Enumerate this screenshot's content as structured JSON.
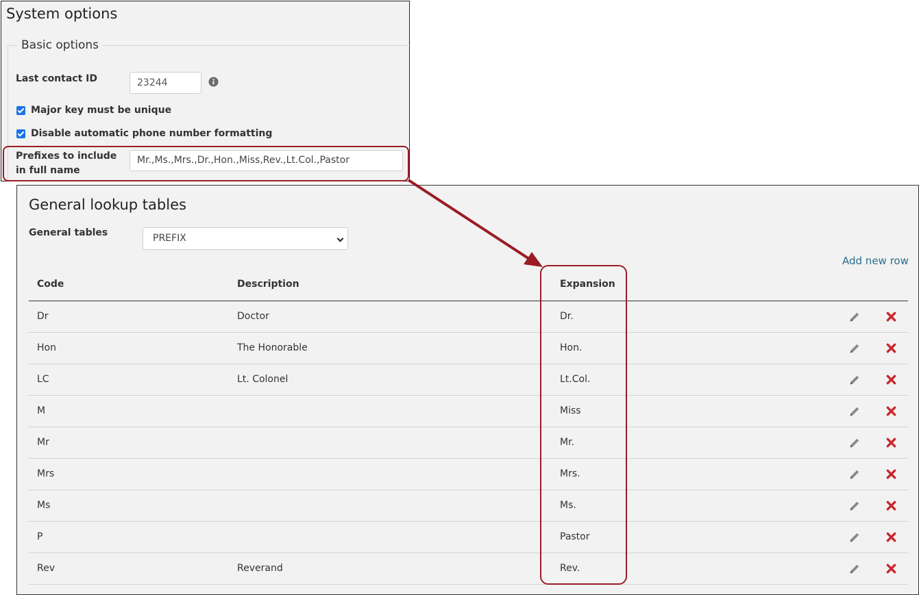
{
  "system_options": {
    "title": "System options",
    "section_legend": "Basic options",
    "last_contact_id": {
      "label": "Last contact ID",
      "value": "23244"
    },
    "checkboxes": [
      {
        "label": "Major key must be unique",
        "checked": true
      },
      {
        "label": "Disable automatic phone number formatting",
        "checked": true
      }
    ],
    "prefixes": {
      "label": "Prefixes to include in full name",
      "value": "Mr.,Ms.,Mrs.,Dr.,Hon.,Miss,Rev.,Lt.Col.,Pastor"
    }
  },
  "lookup": {
    "title": "General lookup tables",
    "general_tables_label": "General tables",
    "selected_table": "PREFIX",
    "add_new_row": "Add new row",
    "columns": [
      "Code",
      "Description",
      "Expansion"
    ],
    "rows": [
      {
        "code": "Dr",
        "description": "Doctor",
        "expansion": "Dr."
      },
      {
        "code": "Hon",
        "description": "The Honorable",
        "expansion": "Hon."
      },
      {
        "code": "LC",
        "description": "Lt. Colonel",
        "expansion": "Lt.Col."
      },
      {
        "code": "M",
        "description": "",
        "expansion": "Miss"
      },
      {
        "code": "Mr",
        "description": "",
        "expansion": "Mr."
      },
      {
        "code": "Mrs",
        "description": "",
        "expansion": "Mrs."
      },
      {
        "code": "Ms",
        "description": "",
        "expansion": "Ms."
      },
      {
        "code": "P",
        "description": "",
        "expansion": "Pastor"
      },
      {
        "code": "Rev",
        "description": "Reverand",
        "expansion": "Rev."
      }
    ]
  },
  "icons": {
    "info": "info-icon",
    "edit": "pencil-icon",
    "delete": "x-icon",
    "dropdown": "chevron-down-icon"
  },
  "colors": {
    "highlight": "#9b1c24",
    "link": "#2a6f8a",
    "delete": "#c8262c",
    "checkbox": "#1a73e8"
  }
}
